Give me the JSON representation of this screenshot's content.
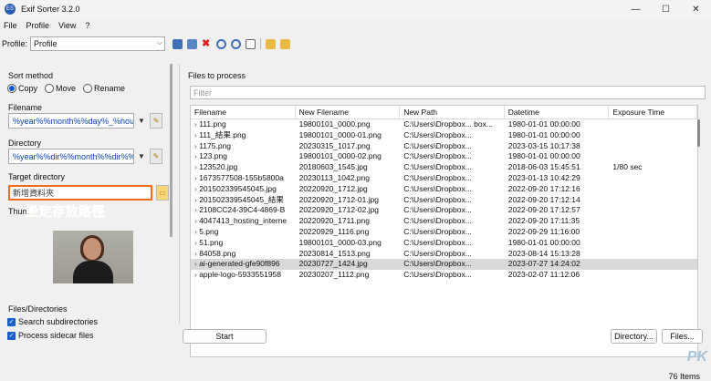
{
  "window": {
    "title": "Exif Sorter 3.2.0",
    "icon_text": "ES",
    "minimize": "—",
    "maximize": "☐",
    "close": "✕"
  },
  "menu": [
    "File",
    "Profile",
    "View",
    "?"
  ],
  "toolbar": {
    "profile_label": "Profile:",
    "profile_value": "Profile"
  },
  "left": {
    "sort_method_label": "Sort method",
    "radios": [
      {
        "label": "Copy",
        "checked": true
      },
      {
        "label": "Move",
        "checked": false
      },
      {
        "label": "Rename",
        "checked": false
      }
    ],
    "filename_label": "Filename",
    "filename_value": "%year%%month%%day%_%hou",
    "directory_label": "Directory",
    "directory_value": "%year%%dir%%month%%dir%%",
    "target_label": "Target directory",
    "target_value": "新增資料夾",
    "thumbnail_label": "Thum",
    "annotation": "設定存放路徑",
    "files_dirs_label": "Files/Directories",
    "checkboxes": [
      {
        "label": "Search subdirectories",
        "checked": true
      },
      {
        "label": "Process sidecar files",
        "checked": true
      }
    ]
  },
  "right": {
    "files_label": "Files to process",
    "filter_placeholder": "Filter",
    "columns": [
      "Filename",
      "New Filename",
      "New Path",
      "Datetime",
      "Exposure Time"
    ],
    "rows": [
      [
        "111.png",
        "19800101_0000.png",
        "C:\\Users\\Dropbox... box...",
        "1980-01-01 00:00:00",
        ""
      ],
      [
        "111_結果.png",
        "19800101_0000-01.png",
        "C:\\Users\\Dropbox...",
        "1980-01-01 00:00:00",
        ""
      ],
      [
        "1175.png",
        "20230315_1017.png",
        "C:\\Users\\Dropbox...",
        "2023-03-15 10:17:38",
        ""
      ],
      [
        "123.png",
        "19800101_0000-02.png",
        "C:\\Users\\Dropbox...",
        "1980-01-01 00:00:00",
        ""
      ],
      [
        "123520.jpg",
        "20180603_1545.jpg",
        "C:\\Users\\Dropbox...",
        "2018-06-03 15:45:51",
        "1/80 sec"
      ],
      [
        "1673577508-155b5800a",
        "20230113_1042.png",
        "C:\\Users\\Dropbox...",
        "2023-01-13 10:42:29",
        ""
      ],
      [
        "201502339545045.jpg",
        "20220920_1712.jpg",
        "C:\\Users\\Dropbox...",
        "2022-09-20 17:12:16",
        ""
      ],
      [
        "201502339545045_結果",
        "20220920_1712-01.jpg",
        "C:\\Users\\Dropbox...",
        "2022-09-20 17:12:14",
        ""
      ],
      [
        "2108CC24-39C4-4869-B",
        "20220920_1712-02.jpg",
        "C:\\Users\\Dropbox...",
        "2022-09-20 17:12:57",
        ""
      ],
      [
        "4047413_hosting_interne",
        "20220920_1711.png",
        "C:\\Users\\Dropbox...",
        "2022-09-20 17:11:35",
        ""
      ],
      [
        "5.png",
        "20220929_1116.png",
        "C:\\Users\\Dropbox...",
        "2022-09-29 11:16:00",
        ""
      ],
      [
        "51.png",
        "19800101_0000-03.png",
        "C:\\Users\\Dropbox...",
        "1980-01-01 00:00:00",
        ""
      ],
      [
        "84058.png",
        "20230814_1513.png",
        "C:\\Users\\Dropbox...",
        "2023-08-14 15:13:28",
        ""
      ],
      [
        "ai-generated-gfe90f896",
        "20230727_1424.jpg",
        "C:\\Users\\Dropbox...",
        "2023-07-27 14:24:02",
        ""
      ],
      [
        "apple-logo-5933551958",
        "20230207_1112.png",
        "C:\\Users\\Dropbox...",
        "2023-02-07 11:12:06",
        ""
      ]
    ],
    "selected_row": 13,
    "items_count": "76 Items",
    "start_label": "Start",
    "directory_button": "Directory...",
    "files_button": "Files..."
  },
  "watermark": "PK"
}
